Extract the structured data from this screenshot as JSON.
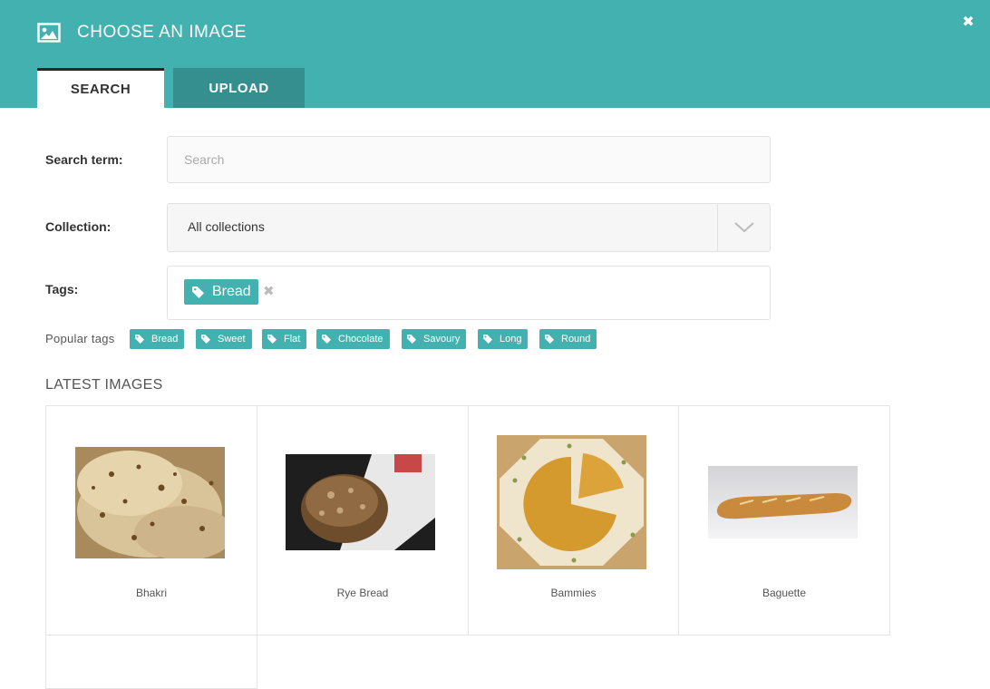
{
  "header": {
    "title": "CHOOSE AN IMAGE",
    "close_label": "✖"
  },
  "tabs": {
    "search": "SEARCH",
    "upload": "UPLOAD"
  },
  "form": {
    "search_label": "Search term:",
    "search_placeholder": "Search",
    "collection_label": "Collection:",
    "collection_value": "All collections",
    "tags_label": "Tags:",
    "selected_tag": "Bread",
    "remove_label": "✖"
  },
  "popular": {
    "label": "Popular tags",
    "tags": [
      "Bread",
      "Sweet",
      "Flat",
      "Chocolate",
      "Savoury",
      "Long",
      "Round"
    ]
  },
  "latest": {
    "title": "LATEST IMAGES",
    "images": [
      {
        "caption": "Bhakri"
      },
      {
        "caption": "Rye Bread"
      },
      {
        "caption": "Bammies"
      },
      {
        "caption": "Baguette"
      }
    ]
  },
  "colors": {
    "accent": "#43b1b0",
    "accent_dark": "#358f8e"
  }
}
